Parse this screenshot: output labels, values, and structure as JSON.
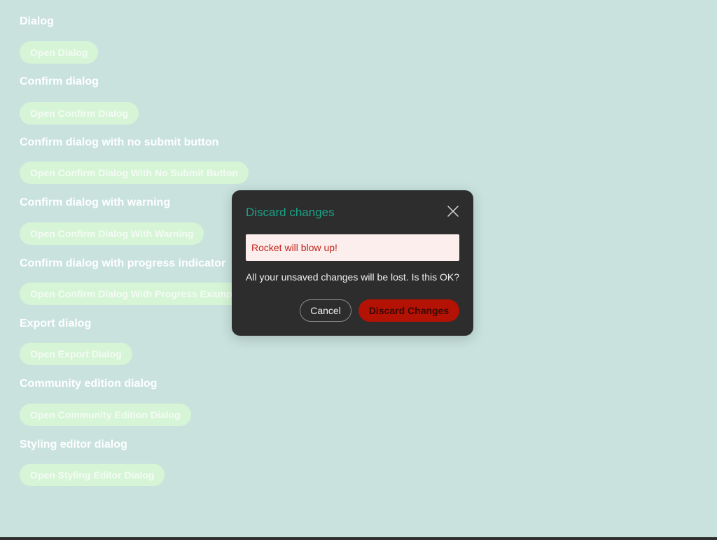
{
  "sections": [
    {
      "title": "Dialog",
      "button": "Open Dialog"
    },
    {
      "title": "Confirm dialog",
      "button": "Open Confirm Dialog"
    },
    {
      "title": "Confirm dialog with no submit button",
      "button": "Open Confirm Dialog With No Submit Button"
    },
    {
      "title": "Confirm dialog with warning",
      "button": "Open Confirm Dialog With Warning"
    },
    {
      "title": "Confirm dialog with progress indicator",
      "button": "Open Confirm Dialog With Progress Example"
    },
    {
      "title": "Export dialog",
      "button": "Open Export Dialog"
    },
    {
      "title": "Community edition dialog",
      "button": "Open Community Edition Dialog"
    },
    {
      "title": "Styling editor dialog",
      "button": "Open Styling Editor Dialog"
    }
  ],
  "dialog": {
    "title": "Discard changes",
    "close_icon": "close-icon",
    "warning": "Rocket will blow up!",
    "message": "All your unsaved changes will be lost. Is this OK?",
    "cancel_label": "Cancel",
    "confirm_label": "Discard Changes"
  },
  "colors": {
    "background": "#c9e2de",
    "dialog_background": "#2d2d2d",
    "dialog_title": "#1aa287",
    "warning_background": "#fdeeee",
    "warning_text": "#c0231a",
    "danger_button": "#b31204",
    "section_button": "#d5f5d6"
  }
}
